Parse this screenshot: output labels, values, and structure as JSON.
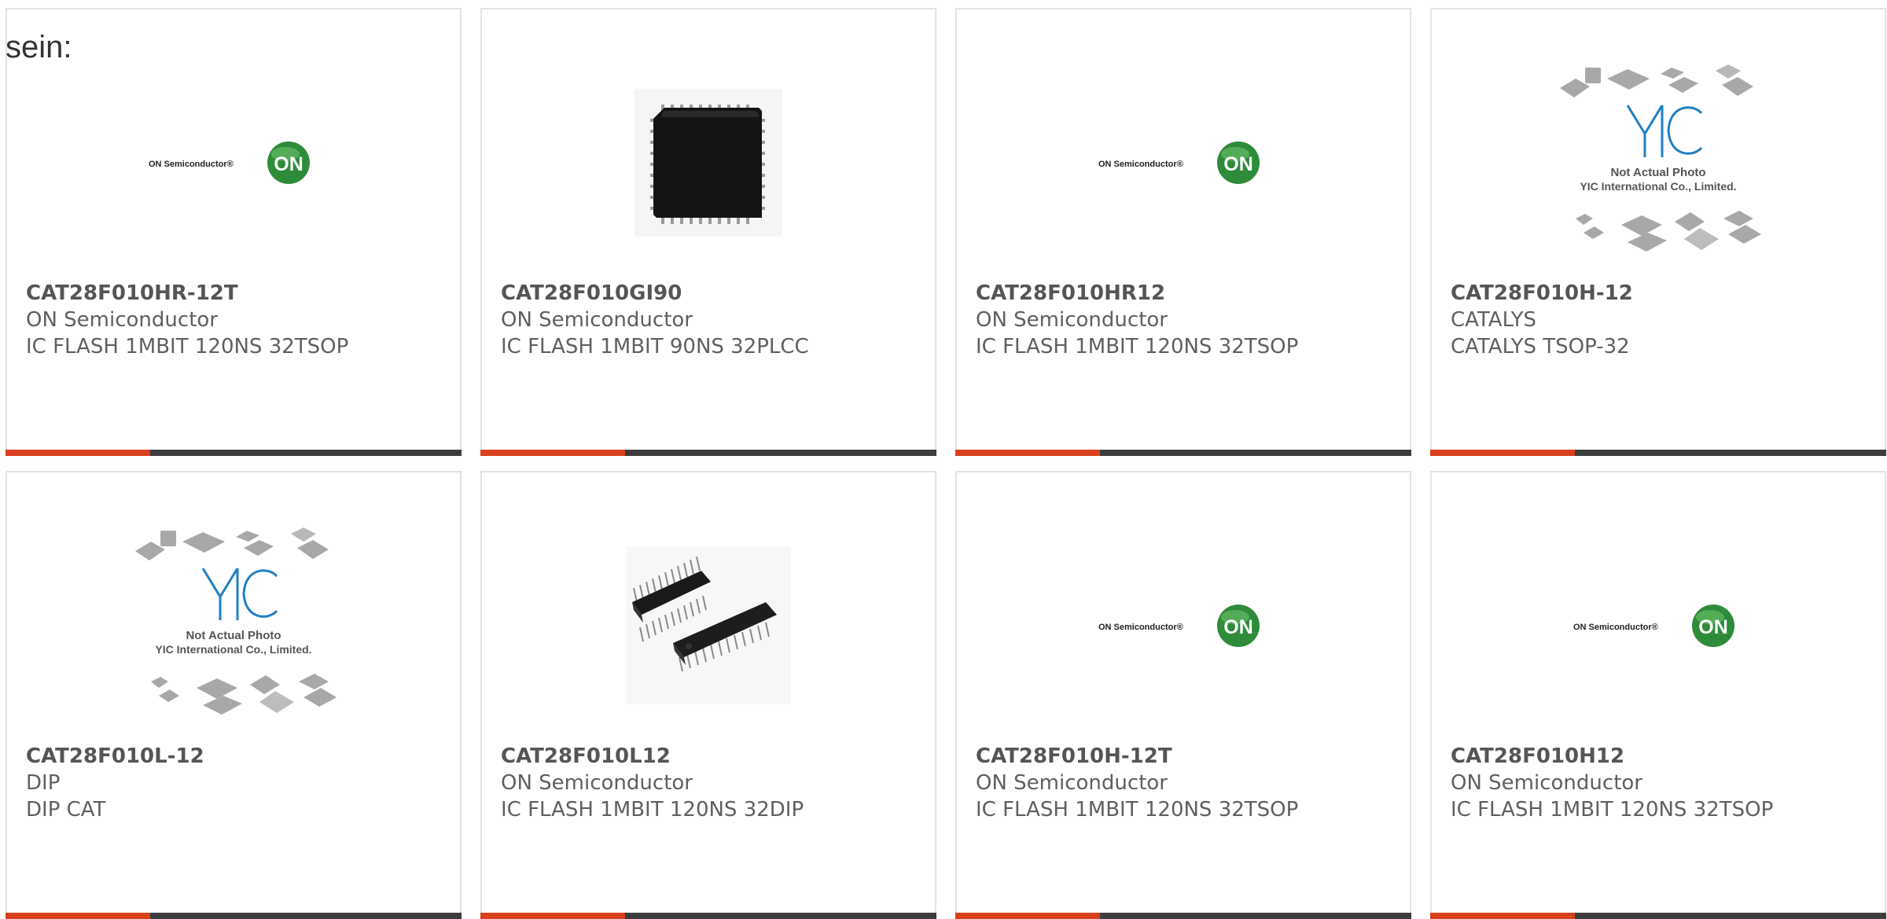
{
  "intro_text": "sein:",
  "products": [
    {
      "part": "CAT28F010HR-12T",
      "maker": "ON Semiconductor",
      "desc": "IC FLASH 1MBIT 120NS 32TSOP",
      "image": "on-semiconductor-logo"
    },
    {
      "part": "CAT28F010GI90",
      "maker": "ON Semiconductor",
      "desc": "IC FLASH 1MBIT 90NS 32PLCC",
      "image": "plcc-chip-photo"
    },
    {
      "part": "CAT28F010HR12",
      "maker": "ON Semiconductor",
      "desc": "IC FLASH 1MBIT 120NS 32TSOP",
      "image": "on-semiconductor-logo"
    },
    {
      "part": "CAT28F010H-12",
      "maker": "CATALYS",
      "desc": "CATALYS TSOP-32",
      "image": "yic-placeholder"
    },
    {
      "part": "CAT28F010L-12",
      "maker": "DIP",
      "desc": "DIP CAT",
      "image": "yic-placeholder"
    },
    {
      "part": "CAT28F010L12",
      "maker": "ON Semiconductor",
      "desc": "IC FLASH 1MBIT 120NS 32DIP",
      "image": "dip-chip-photo"
    },
    {
      "part": "CAT28F010H-12T",
      "maker": "ON Semiconductor",
      "desc": "IC FLASH 1MBIT 120NS 32TSOP",
      "image": "on-semiconductor-logo"
    },
    {
      "part": "CAT28F010H12",
      "maker": "ON Semiconductor",
      "desc": "IC FLASH 1MBIT 120NS 32TSOP",
      "image": "on-semiconductor-logo"
    }
  ],
  "logo_text": {
    "brand": "ON Semiconductor®",
    "badge": "ON"
  },
  "placeholder_text": {
    "line1": "Not Actual Photo",
    "line2": "YIC International Co., Limited."
  },
  "colors": {
    "accent": "#d9401c",
    "bar": "#3d3d3d",
    "on_green": "#2e8b3a",
    "yic_blue": "#1f7fc4"
  }
}
